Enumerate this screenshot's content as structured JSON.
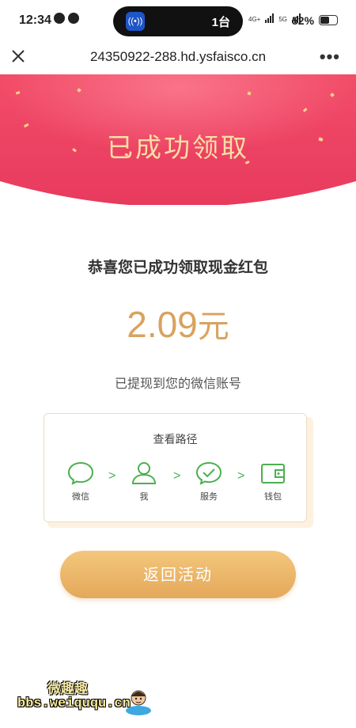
{
  "status_bar": {
    "time": "12:34",
    "island_label": "1台",
    "island_icon_text": "((•))",
    "network_1": "4G+",
    "network_2": "5G",
    "battery": "52%"
  },
  "nav": {
    "url": "24350922-288.hd.ysfaisco.cn",
    "more_label": "•••"
  },
  "hero": {
    "title": "已成功领取"
  },
  "main": {
    "congrats": "恭喜您已成功领取现金红包",
    "amount_value": "2.09",
    "amount_unit": "元",
    "withdrawn_note": "已提现到您的微信账号"
  },
  "path_card": {
    "title": "查看路径",
    "steps": [
      {
        "label": "微信",
        "icon": "chat-bubble-icon"
      },
      {
        "label": "我",
        "icon": "user-icon"
      },
      {
        "label": "服务",
        "icon": "check-bubble-icon"
      },
      {
        "label": "钱包",
        "icon": "wallet-icon"
      }
    ],
    "arrow": ">"
  },
  "return_button": {
    "label": "返回活动"
  },
  "watermark": {
    "line1": "微趣趣",
    "line2": "bbs.weiququ.cn"
  },
  "colors": {
    "hero_red": "#ef4a6a",
    "gold_text": "#d9a25e",
    "icon_green": "#4caf50",
    "button_gold": "#e4a85a"
  }
}
